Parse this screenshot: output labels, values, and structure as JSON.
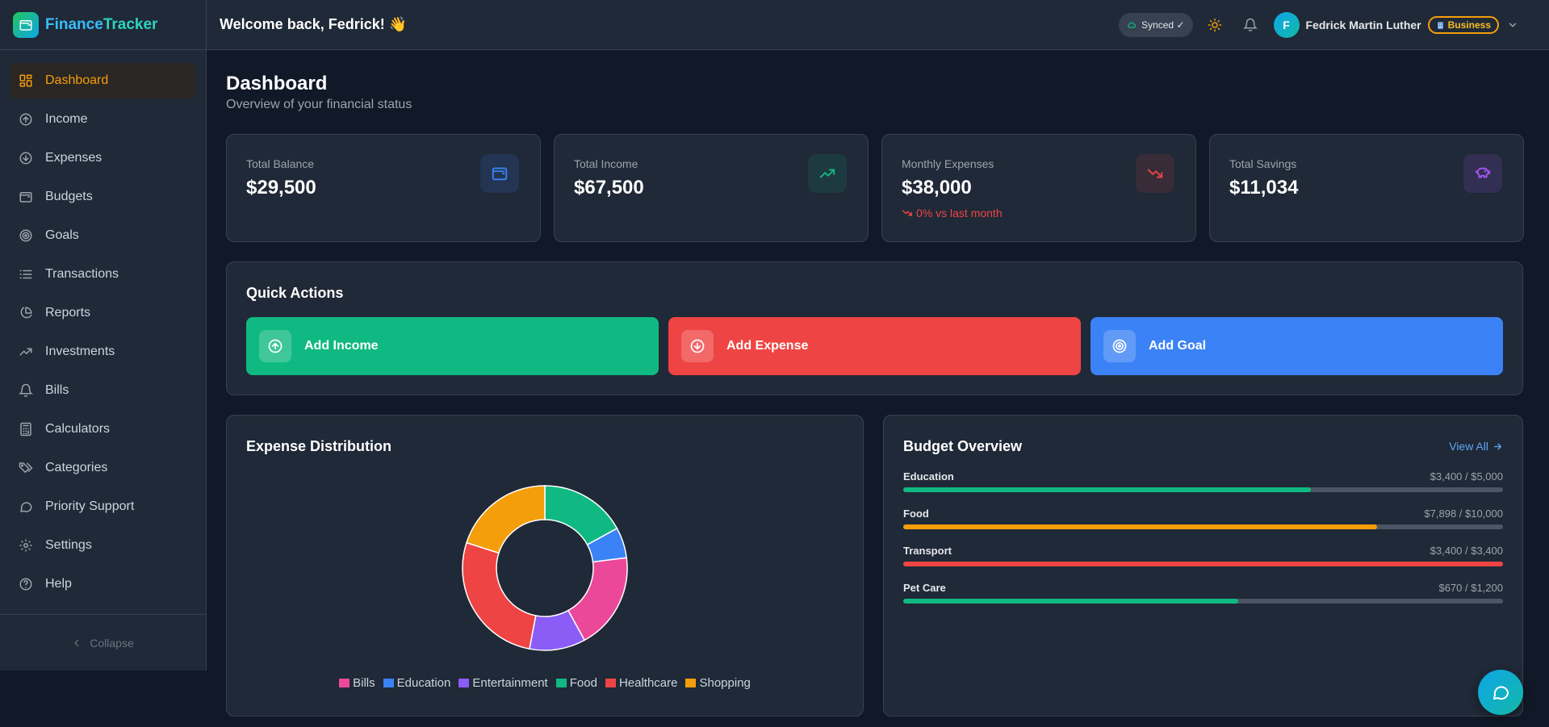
{
  "brand": {
    "name_part1": "Finance",
    "name_part2": "Tracker"
  },
  "header": {
    "welcome": "Welcome back, Fedrick! 👋",
    "synced_label": "Synced ✓",
    "user_initial": "F",
    "user_name": "Fedrick Martin Luther",
    "plan_badge": "Business"
  },
  "sidebar": {
    "items": [
      {
        "label": "Dashboard",
        "icon": "dashboard-grid-icon",
        "active": true
      },
      {
        "label": "Income",
        "icon": "arrow-up-circle-icon"
      },
      {
        "label": "Expenses",
        "icon": "arrow-down-circle-icon"
      },
      {
        "label": "Budgets",
        "icon": "wallet-icon"
      },
      {
        "label": "Goals",
        "icon": "target-icon"
      },
      {
        "label": "Transactions",
        "icon": "list-icon"
      },
      {
        "label": "Reports",
        "icon": "pie-chart-icon"
      },
      {
        "label": "Investments",
        "icon": "trending-up-icon"
      },
      {
        "label": "Bills",
        "icon": "bell-icon"
      },
      {
        "label": "Calculators",
        "icon": "calculator-icon"
      },
      {
        "label": "Categories",
        "icon": "tags-icon"
      },
      {
        "label": "Priority Support",
        "icon": "chat-bubble-icon"
      },
      {
        "label": "Settings",
        "icon": "gear-icon"
      },
      {
        "label": "Help",
        "icon": "help-circle-icon"
      }
    ],
    "collapse_label": "Collapse"
  },
  "page": {
    "title": "Dashboard",
    "subtitle": "Overview of your financial status"
  },
  "stats": [
    {
      "label": "Total Balance",
      "value": "$29,500",
      "icon": "wallet-icon",
      "color": "#3b82f6"
    },
    {
      "label": "Total Income",
      "value": "$67,500",
      "icon": "trending-up-icon",
      "color": "#10b981"
    },
    {
      "label": "Monthly Expenses",
      "value": "$38,000",
      "icon": "trending-down-icon",
      "color": "#ef4444",
      "trend": "0% vs last month"
    },
    {
      "label": "Total Savings",
      "value": "$11,034",
      "icon": "piggy-bank-icon",
      "color": "#a855f7"
    }
  ],
  "quick_actions": {
    "title": "Quick Actions",
    "buttons": [
      {
        "label": "Add Income",
        "color": "#10b981",
        "icon": "arrow-up-circle-icon"
      },
      {
        "label": "Add Expense",
        "color": "#ef4444",
        "icon": "arrow-down-circle-icon"
      },
      {
        "label": "Add Goal",
        "color": "#3b82f6",
        "icon": "target-icon"
      }
    ]
  },
  "expense_distribution": {
    "title": "Expense Distribution",
    "chart_data": {
      "type": "pie",
      "categories": [
        "Bills",
        "Education",
        "Entertainment",
        "Food",
        "Healthcare",
        "Shopping"
      ],
      "values": [
        19,
        6,
        11,
        17,
        27,
        20
      ],
      "colors": [
        "#ec4899",
        "#3b82f6",
        "#8b5cf6",
        "#10b981",
        "#ef4444",
        "#f59e0b"
      ]
    }
  },
  "budget_overview": {
    "title": "Budget Overview",
    "view_all": "View All",
    "items": [
      {
        "category": "Education",
        "amount": "$3,400 / $5,000",
        "progress": 0.68,
        "color": "#10b981"
      },
      {
        "category": "Food",
        "amount": "$7,898 / $10,000",
        "progress": 0.79,
        "color": "#f59e0b"
      },
      {
        "category": "Transport",
        "amount": "$3,400 / $3,400",
        "progress": 1.0,
        "color": "#ef4444"
      },
      {
        "category": "Pet Care",
        "amount": "$670 / $1,200",
        "progress": 0.558,
        "color": "#10b981"
      }
    ]
  }
}
